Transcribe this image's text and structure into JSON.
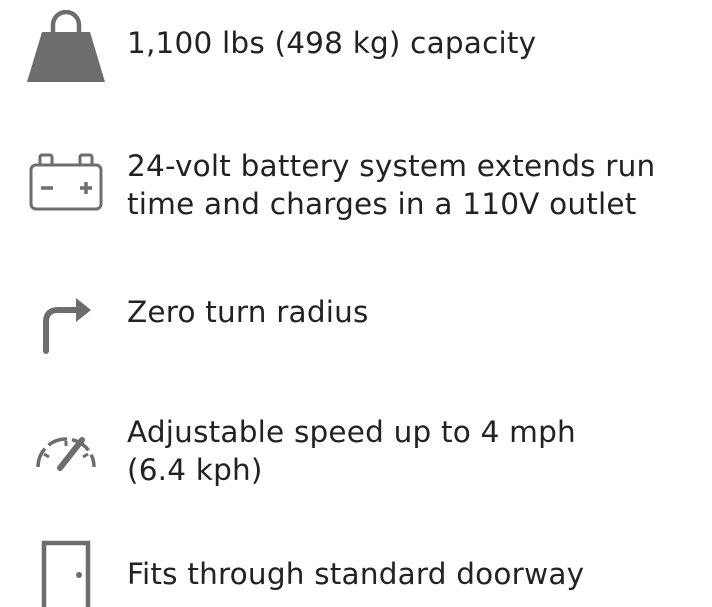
{
  "features": [
    {
      "icon": "weight-icon",
      "lines": [
        "1,100 lbs (498 kg) capacity"
      ]
    },
    {
      "icon": "battery-icon",
      "lines": [
        "24-volt battery system extends run",
        "time and charges in a 110V outlet"
      ]
    },
    {
      "icon": "turn-arrow-icon",
      "lines": [
        "Zero turn radius"
      ]
    },
    {
      "icon": "speedometer-icon",
      "lines": [
        "Adjustable speed up to 4 mph",
        "(6.4 kph)"
      ]
    },
    {
      "icon": "door-icon",
      "lines": [
        "Fits through standard doorway"
      ]
    }
  ],
  "colors": {
    "icon": "#6d6d6d",
    "text": "#222222"
  }
}
